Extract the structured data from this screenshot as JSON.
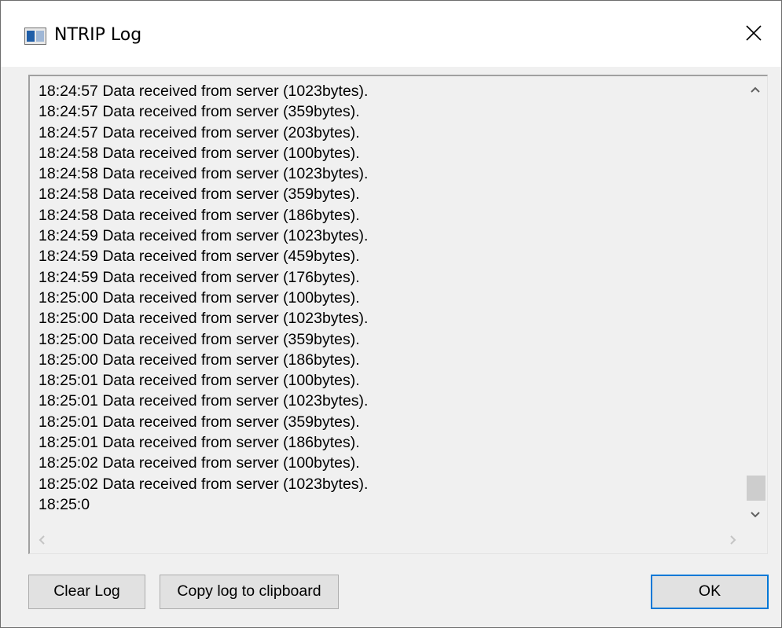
{
  "window": {
    "title": "NTRIP Log"
  },
  "log": {
    "lines": [
      "18:24:57 Data received from server (1023bytes).",
      "18:24:57 Data received from server (359bytes).",
      "18:24:57 Data received from server (203bytes).",
      "18:24:58 Data received from server (100bytes).",
      "18:24:58 Data received from server (1023bytes).",
      "18:24:58 Data received from server (359bytes).",
      "18:24:58 Data received from server (186bytes).",
      "18:24:59 Data received from server (1023bytes).",
      "18:24:59 Data received from server (459bytes).",
      "18:24:59 Data received from server (176bytes).",
      "18:25:00 Data received from server (100bytes).",
      "18:25:00 Data received from server (1023bytes).",
      "18:25:00 Data received from server (359bytes).",
      "18:25:00 Data received from server (186bytes).",
      "18:25:01 Data received from server (100bytes).",
      "18:25:01 Data received from server (1023bytes).",
      "18:25:01 Data received from server (359bytes).",
      "18:25:01 Data received from server (186bytes).",
      "18:25:02 Data received from server (100bytes).",
      "18:25:02 Data received from server (1023bytes).",
      "18:25:0"
    ]
  },
  "buttons": {
    "clear_log": "Clear Log",
    "copy_log": "Copy log to clipboard",
    "ok": "OK"
  },
  "icons": {
    "close": "close-icon",
    "app": "app-window-icon",
    "scroll_up": "chevron-up-icon",
    "scroll_down": "chevron-down-icon",
    "scroll_left": "chevron-left-icon",
    "scroll_right": "chevron-right-icon"
  },
  "colors": {
    "window_bg": "#f0f0f0",
    "titlebar_bg": "#ffffff",
    "ok_border": "#0078d7",
    "button_bg": "#e1e1e1"
  }
}
